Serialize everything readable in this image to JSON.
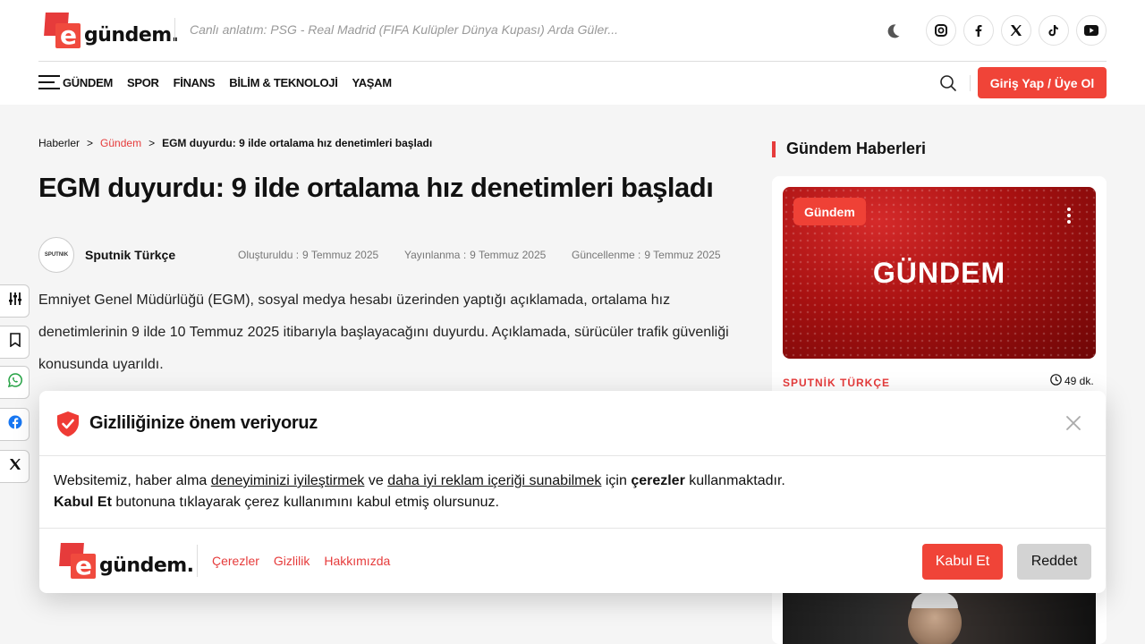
{
  "header": {
    "logo_letter": "e",
    "logo_text": "gündem.",
    "live_text": "Canlı anlatım: PSG - Real Madrid (FIFA Kulüpler Dünya Kupası) Arda Güler...",
    "social": [
      "instagram-icon",
      "facebook-icon",
      "x-icon",
      "tiktok-icon",
      "youtube-icon"
    ],
    "nav": [
      "GÜNDEM",
      "SPOR",
      "FİNANS",
      "BİLİM & TEKNOLOJİ",
      "YAŞAM"
    ],
    "login_label": "Giriş Yap / Üye Ol"
  },
  "breadcrumb": {
    "home": "Haberler",
    "sep": ">",
    "category": "Gündem",
    "current": "EGM duyurdu: 9 ilde ortalama hız denetimleri başladı"
  },
  "article": {
    "title": "EGM duyurdu: 9 ilde ortalama hız denetimleri başladı",
    "avatar_text": "SPUTNIK",
    "author": "Sputnik Türkçe",
    "created_label": "Oluşturuldu :",
    "created": "9 Temmuz 2025",
    "published_label": "Yayınlanma :",
    "published": "9 Temmuz 2025",
    "updated_label": "Güncellenme :",
    "updated": "9 Temmuz 2025",
    "body": "Emniyet Genel Müdürlüğü (EGM), sosyal medya hesabı üzerinden yaptığı açıklamada, ortalama hız denetimlerinin 9 ilde 10 Temmuz 2025 itibarıyla başlayacağını duyurdu. Açıklamada, sürücüler trafik güvenliği konusunda uyarıldı."
  },
  "sidebar": {
    "title": "Gündem Haberleri",
    "card": {
      "badge": "Gündem",
      "image_text": "GÜNDEM",
      "source": "SPUTNİK TÜRKÇE",
      "read_time": "49 dk."
    }
  },
  "cookie": {
    "title": "Gizliliğinize önem veriyoruz",
    "line1_a": "Websitemiz, haber alma ",
    "line1_link1": "deneyiminizi iyileştirmek",
    "line1_b": " ve ",
    "line1_link2": "daha iyi reklam içeriği sunabilmek",
    "line1_c": " için ",
    "line1_bold": "çerezler",
    "line1_d": " kullanmaktadır.",
    "line2_bold": "Kabul Et",
    "line2_rest": " butonuna tıklayarak çerez kullanımını kabul etmiş olursunuz.",
    "links": [
      "Çerezler",
      "Gizlilik",
      "Hakkımızda"
    ],
    "accept_label": "Kabul Et",
    "reject_label": "Reddet"
  },
  "colors": {
    "accent": "#f04438",
    "brand_red": "#e63b3b"
  }
}
